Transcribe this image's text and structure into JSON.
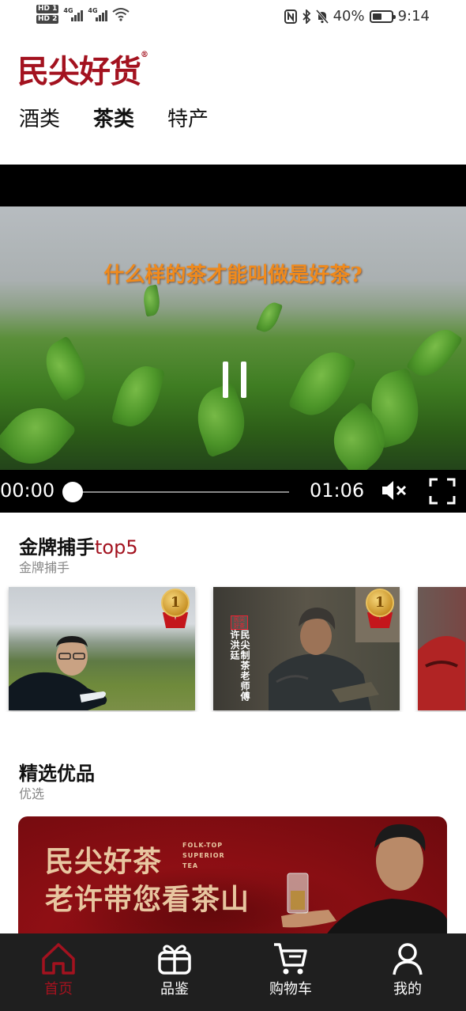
{
  "status_bar": {
    "time": "9:14",
    "battery": "40%",
    "sim1": "HD 1",
    "sim2": "HD 2",
    "net1": "4G",
    "net2": "4G"
  },
  "app": {
    "logo": "民尖好货"
  },
  "top_tabs": [
    {
      "label": "酒类",
      "active": false
    },
    {
      "label": "茶类",
      "active": true
    },
    {
      "label": "特产",
      "active": false
    }
  ],
  "video": {
    "caption": "什么样的茶才能叫做是好茶?",
    "current_time": "00:00",
    "total_time": "01:06",
    "progress": 0,
    "muted": true
  },
  "section_gold": {
    "title": "金牌捕手",
    "title_accent": "top5",
    "subtitle": "金牌捕手",
    "cards": [
      {
        "rank": "1"
      },
      {
        "rank": "1",
        "badge_text": "民尖 好茶",
        "overlay_text": "民尖制茶老师傅 许洪廷"
      },
      {
        "rank": ""
      }
    ]
  },
  "section_selected": {
    "title": "精选优品",
    "subtitle": "优选",
    "banner": {
      "line1": "民尖好茶",
      "line2": "老许带您看茶山",
      "en1": "FOLK-TOP",
      "en2": "SUPERIOR",
      "en3": "TEA"
    }
  },
  "bottom_nav": [
    {
      "label": "首页",
      "icon": "home-icon",
      "active": true
    },
    {
      "label": "品鉴",
      "icon": "gift-icon",
      "active": false
    },
    {
      "label": "购物车",
      "icon": "cart-icon",
      "active": false
    },
    {
      "label": "我的",
      "icon": "user-icon",
      "active": false
    }
  ],
  "colors": {
    "brand": "#a3121f",
    "nav_bg": "#1f1f1f",
    "caption": "#f08a1c"
  }
}
